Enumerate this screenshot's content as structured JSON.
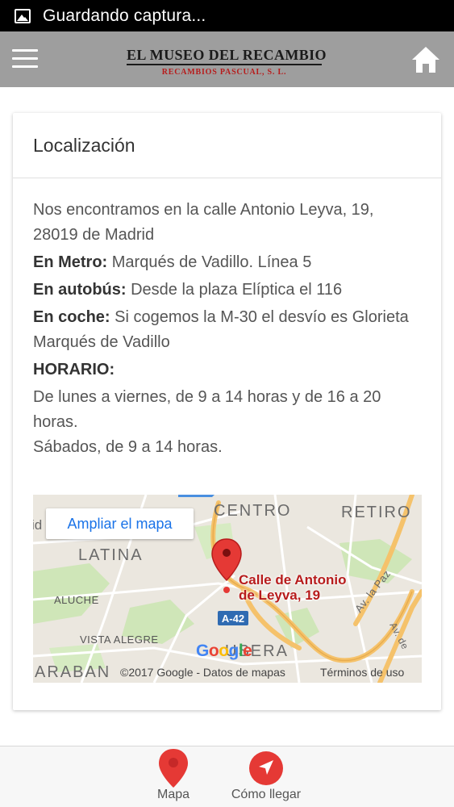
{
  "status_bar": {
    "text": "Guardando captura..."
  },
  "header": {
    "logo_main": "EL MUSEO DEL RECAMBIO",
    "logo_sub": "RECAMBIOS PASCUAL, S. L."
  },
  "card": {
    "title": "Localización",
    "address": "Nos encontramos en la calle Antonio Leyva, 19, 28019 de Madrid",
    "metro_label": "En Metro:",
    "metro_text": " Marqués de Vadillo. Línea 5",
    "bus_label": "En autobús:",
    "bus_text": " Desde la plaza Elíptica el 116",
    "car_label": "En coche:",
    "car_text": " Si cogemos la M-30 el desvío es Glorieta Marqués de Vadillo",
    "hours_label": "HORARIO:",
    "hours_weekdays": "De lunes a viernes, de 9 a 14 horas y de 16 a 20 horas.",
    "hours_saturday": "Sábados, de 9 a 14 horas."
  },
  "map": {
    "expand_label": "Ampliar el mapa",
    "partial_left": "id",
    "districts": {
      "centro": "CENTRO",
      "retiro": "RETIRO",
      "latina": "LATINA",
      "usera": "USERA",
      "carabanchel": "ARABAN"
    },
    "neighborhoods": {
      "aluche": "ALUCHE",
      "vista_alegre": "VISTA ALEGRE"
    },
    "streets": {
      "av_paz": "Av. la Paz",
      "av_entrevias": "Av. de"
    },
    "road_shield": "A-42",
    "marker_label_line1": "Calle de Antonio",
    "marker_label_line2": "de Leyva, 19",
    "google": [
      "G",
      "o",
      "o",
      "g",
      "l",
      "e"
    ],
    "copyright": "©2017 Google - Datos de mapas",
    "terms": "Términos de uso",
    "colors": {
      "marker": "#e53935",
      "road": "#f5c26b",
      "park": "#c8e6b0",
      "water": "#aadaff"
    }
  },
  "bottom_nav": {
    "map_label": "Mapa",
    "directions_label": "Cómo llegar",
    "accent_color": "#e53935"
  }
}
